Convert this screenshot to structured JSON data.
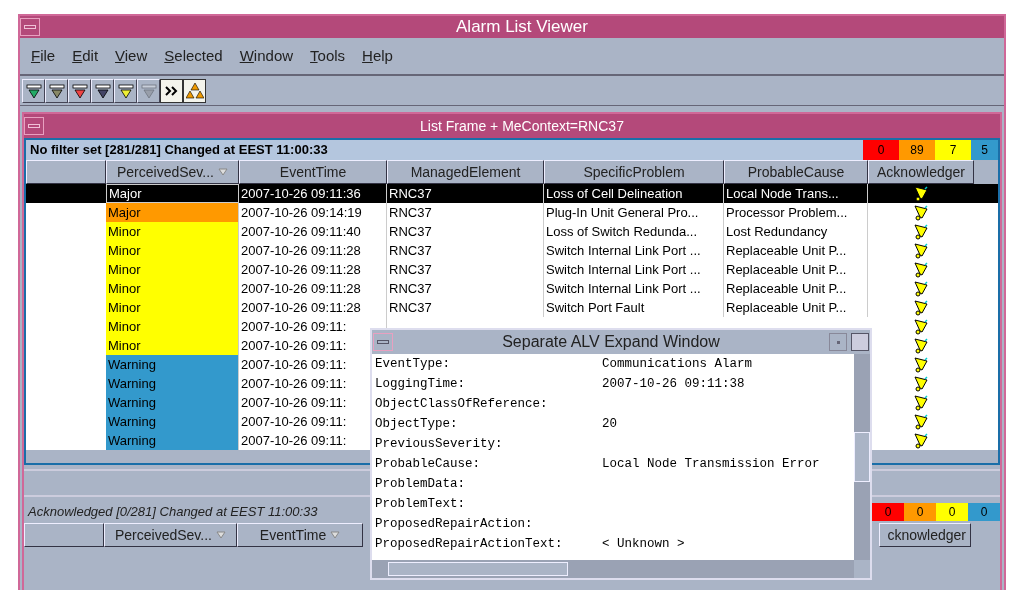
{
  "window": {
    "title": "Alarm List Viewer"
  },
  "menu": [
    "File",
    "Edit",
    "View",
    "Selected",
    "Window",
    "Tools",
    "Help"
  ],
  "toolbar": [
    {
      "disabled": false,
      "pressed": false
    },
    {
      "disabled": false,
      "pressed": false
    },
    {
      "disabled": false,
      "pressed": false
    },
    {
      "disabled": false,
      "pressed": false
    },
    {
      "disabled": false,
      "pressed": false
    },
    {
      "disabled": true,
      "pressed": false
    },
    {
      "disabled": false,
      "pressed": true
    },
    {
      "disabled": false,
      "pressed": true
    }
  ],
  "list_frame": {
    "title": "List Frame + MeContext=RNC37"
  },
  "upper": {
    "status": "No filter set [281/281]  Changed at EEST 11:00:33",
    "counts": [
      {
        "value": "0",
        "color": "#ff0000"
      },
      {
        "value": "89",
        "color": "#ff9900"
      },
      {
        "value": "7",
        "color": "#ffff00"
      },
      {
        "value": "5",
        "color": "#3399cc"
      }
    ],
    "columns": [
      "PerceivedSev...",
      "EventTime",
      "ManagedElement",
      "SpecificProblem",
      "ProbableCause",
      "Acknowledger"
    ],
    "rows": [
      {
        "selected": true,
        "severity": "Major",
        "event_time": "2007-10-26 09:11:36",
        "managed_element": "RNC37",
        "specific_problem": "Loss of Cell Delineation",
        "probable_cause": "Local Node Trans..."
      },
      {
        "selected": false,
        "severity": "Major",
        "color": "#ff9900",
        "event_time": "2007-10-26 09:14:19",
        "managed_element": "RNC37",
        "specific_problem": "Plug-In Unit General Pro...",
        "probable_cause": "Processor Problem..."
      },
      {
        "selected": false,
        "severity": "Minor",
        "color": "#ffff00",
        "event_time": "2007-10-26 09:11:40",
        "managed_element": "RNC37",
        "specific_problem": "Loss of Switch Redunda...",
        "probable_cause": "Lost Redundancy"
      },
      {
        "selected": false,
        "severity": "Minor",
        "color": "#ffff00",
        "event_time": "2007-10-26 09:11:28",
        "managed_element": "RNC37",
        "specific_problem": "Switch Internal Link Port ...",
        "probable_cause": "Replaceable Unit P..."
      },
      {
        "selected": false,
        "severity": "Minor",
        "color": "#ffff00",
        "event_time": "2007-10-26 09:11:28",
        "managed_element": "RNC37",
        "specific_problem": "Switch Internal Link Port ...",
        "probable_cause": "Replaceable Unit P..."
      },
      {
        "selected": false,
        "severity": "Minor",
        "color": "#ffff00",
        "event_time": "2007-10-26 09:11:28",
        "managed_element": "RNC37",
        "specific_problem": "Switch Internal Link Port ...",
        "probable_cause": "Replaceable Unit P..."
      },
      {
        "selected": false,
        "severity": "Minor",
        "color": "#ffff00",
        "event_time": "2007-10-26 09:11:28",
        "managed_element": "RNC37",
        "specific_problem": "Switch Port Fault",
        "probable_cause": "Replaceable Unit P..."
      },
      {
        "selected": false,
        "severity": "Minor",
        "color": "#ffff00",
        "event_time": "2007-10-26 09:11:"
      },
      {
        "selected": false,
        "severity": "Minor",
        "color": "#ffff00",
        "event_time": "2007-10-26 09:11:"
      },
      {
        "selected": false,
        "severity": "Warning",
        "color": "#3399cc",
        "event_time": "2007-10-26 09:11:"
      },
      {
        "selected": false,
        "severity": "Warning",
        "color": "#3399cc",
        "event_time": "2007-10-26 09:11:"
      },
      {
        "selected": false,
        "severity": "Warning",
        "color": "#3399cc",
        "event_time": "2007-10-26 09:11:"
      },
      {
        "selected": false,
        "severity": "Warning",
        "color": "#3399cc",
        "event_time": "2007-10-26 09:11:"
      },
      {
        "selected": false,
        "severity": "Warning",
        "color": "#3399cc",
        "event_time": "2007-10-26 09:11:"
      }
    ]
  },
  "lower": {
    "status": "Acknowledged [0/281]  Changed at EEST 11:00:33",
    "counts": [
      {
        "value": "0",
        "color": "#ff0000"
      },
      {
        "value": "0",
        "color": "#ff9900"
      },
      {
        "value": "0",
        "color": "#ffff00"
      },
      {
        "value": "0",
        "color": "#3399cc"
      }
    ],
    "columns": [
      "PerceivedSev...",
      "EventTime"
    ],
    "column_cut": "cknowledger"
  },
  "expand_window": {
    "title": "Separate ALV Expand Window",
    "fields": [
      {
        "name": "EventType:",
        "value": "Communications Alarm"
      },
      {
        "name": "LoggingTime:",
        "value": "2007-10-26 09:11:38"
      },
      {
        "name": "ObjectClassOfReference:"
      },
      {
        "name": "ObjectType:",
        "value": "20"
      },
      {
        "name": "PreviousSeverity:"
      },
      {
        "name": "ProbableCause:",
        "value": "Local Node Transmission Error"
      },
      {
        "name": "ProblemData:"
      },
      {
        "name": "ProblemText:"
      },
      {
        "name": "ProposedRepairAction:"
      },
      {
        "name": "ProposedRepairActionText:",
        "value": "< Unknown >"
      }
    ]
  }
}
